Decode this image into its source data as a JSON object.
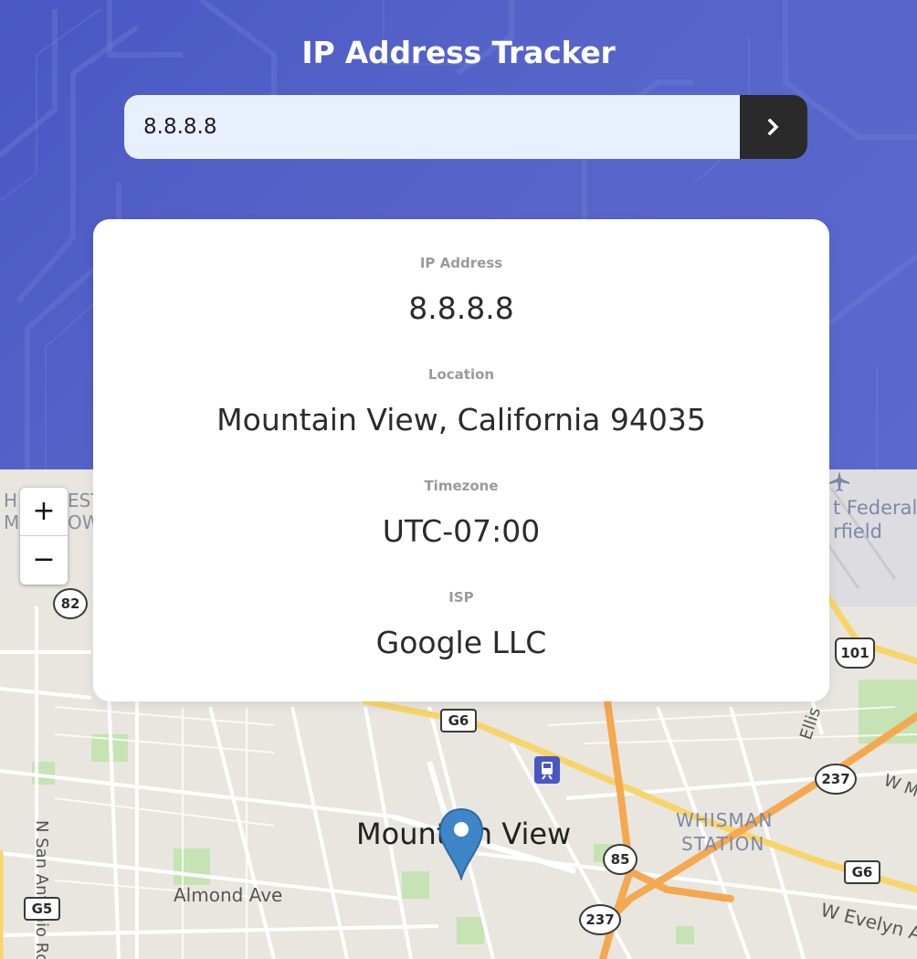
{
  "app": {
    "title": "IP Address Tracker"
  },
  "search": {
    "value": "8.8.8.8",
    "button_icon": "chevron-right-icon"
  },
  "stats": [
    {
      "label": "IP Address",
      "value": "8.8.8.8"
    },
    {
      "label": "Location",
      "value": "Mountain View, California 94035"
    },
    {
      "label": "Timezone",
      "value": "UTC-07:00"
    },
    {
      "label": "ISP",
      "value": "Google LLC"
    }
  ],
  "map": {
    "zoom_in": "+",
    "zoom_out": "−",
    "city_label": "Mountain View",
    "labels": {
      "n_san_antonio": "N San Antonio Rd",
      "almond": "Almond Ave",
      "whisman": "WHISMAN",
      "station": "STATION",
      "w_evelyn": "W Evelyn A",
      "ellis": "Ellis",
      "federal": "t Federal",
      "field": "rfield",
      "w_m": "W M",
      "harvest_1": "H",
      "harvest_1b": "EST",
      "harvest_2": "M",
      "harvest_2b": "OW"
    },
    "shields": {
      "r82": "82",
      "r101": "101",
      "r237a": "237",
      "r85": "85",
      "r237b": "237"
    },
    "routes": {
      "g6a": "G6",
      "g6b": "G6",
      "g5": "G5"
    }
  },
  "colors": {
    "header_bg": "#4f5dc6",
    "search_bg": "#e8f0fd",
    "button_bg": "#2a2a2a",
    "highway": "#f4a850",
    "arterial": "#f7d56a",
    "map_bg": "#e9e6df",
    "marker": "#3f86c9"
  }
}
